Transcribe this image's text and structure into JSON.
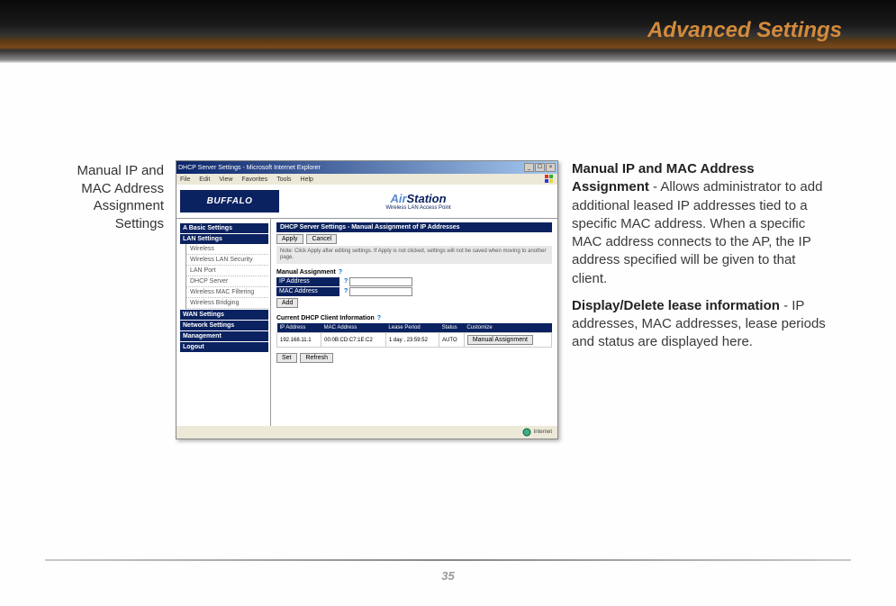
{
  "header": {
    "title": "Advanced Settings"
  },
  "caption": "Manual IP and MAC Address Assignment Settings",
  "window": {
    "title": "DHCP Server Settings - Microsoft Internet Explorer",
    "menus": [
      "File",
      "Edit",
      "View",
      "Favorites",
      "Tools",
      "Help"
    ],
    "brand": "BUFFALO",
    "product": "AirStation",
    "product_sub": "Wireless LAN Access Point",
    "nav": {
      "basic": "A Basic Settings",
      "lan": "LAN Settings",
      "lan_items": [
        "Wireless",
        "Wireless LAN Security",
        "LAN Port",
        "DHCP Server",
        "Wireless MAC Filtering",
        "Wireless Bridging"
      ],
      "wan": "WAN Settings",
      "net": "Network Settings",
      "mgmt": "Management",
      "logout": "Logout"
    },
    "main": {
      "section": "DHCP Server Settings - Manual Assignment of IP Addresses",
      "apply": "Apply",
      "cancel": "Cancel",
      "note": "Note: Click Apply after editing settings. If Apply is not clicked, settings will not be saved when moving to another page.",
      "manual_assign": "Manual Assignment",
      "ip_label": "IP Address",
      "mac_label": "MAC Address",
      "add": "Add",
      "client_info": "Current DHCP Client Information",
      "cols": [
        "IP Address",
        "MAC Address",
        "Lease Period",
        "Status",
        "Customize"
      ],
      "row": {
        "ip": "192.168.11.1",
        "mac": "00:0B:CD:C7:1E:C2",
        "lease": "1 day , 23:59:52",
        "status": "AUTO",
        "cust": "Manual Assignment"
      },
      "set": "Set",
      "refresh": "Refresh"
    },
    "status": "Internet"
  },
  "desc": {
    "b1": "Manual IP and MAC Address Assignment",
    "t1": " - Allows administrator to add additional leased IP addresses tied to a specific MAC address.  When a specific MAC address connects to the AP, the IP address specified will be given to that client.",
    "b2": "Display/Delete lease information",
    "t2": " - IP addresses, MAC addresses, lease periods and status are displayed here."
  },
  "page": "35"
}
